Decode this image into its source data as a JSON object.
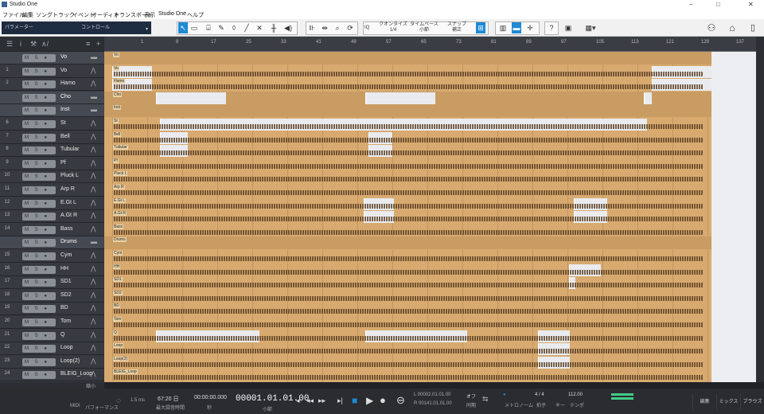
{
  "window": {
    "title": "Studio One"
  },
  "menu": [
    "ファイル",
    "編集",
    "ソング",
    "トラック",
    "イベント",
    "オーディオ",
    "トランスポート",
    "表示",
    "Studio One",
    "ヘルプ"
  ],
  "toolbar": {
    "param_label": "パラメーター",
    "control_label": "コントロール",
    "quantize_label": "クオンタイズ",
    "quantize_value": "1/4",
    "timebase_label": "タイムベース",
    "timebase_value": "小節",
    "snap_label": "スナップ",
    "snap_value": "補正",
    "iq_label": "IQ",
    "help_label": "?"
  },
  "ruler_marks": [
    "1",
    "9",
    "17",
    "25",
    "33",
    "41",
    "49",
    "57",
    "65",
    "73",
    "81",
    "89",
    "97",
    "105",
    "113",
    "121",
    "129",
    "137",
    "145"
  ],
  "tracks": [
    {
      "num": "",
      "name": "Vo",
      "folder": true
    },
    {
      "num": "1",
      "name": "Vo"
    },
    {
      "num": "2",
      "name": "Hamo"
    },
    {
      "num": "",
      "name": "Cho",
      "folder": true
    },
    {
      "num": "",
      "name": "Inst",
      "folder": true
    },
    {
      "num": "6",
      "name": "St"
    },
    {
      "num": "7",
      "name": "Bell"
    },
    {
      "num": "8",
      "name": "Tubular"
    },
    {
      "num": "9",
      "name": "Pf"
    },
    {
      "num": "10",
      "name": "Pluck L"
    },
    {
      "num": "11",
      "name": "Arp R"
    },
    {
      "num": "12",
      "name": "E.Gt L"
    },
    {
      "num": "13",
      "name": "A.Gt R"
    },
    {
      "num": "14",
      "name": "Bass"
    },
    {
      "num": "",
      "name": "Drums",
      "folder": true
    },
    {
      "num": "15",
      "name": "Cym"
    },
    {
      "num": "16",
      "name": "HH"
    },
    {
      "num": "17",
      "name": "SD1"
    },
    {
      "num": "18",
      "name": "SD2"
    },
    {
      "num": "19",
      "name": "BD"
    },
    {
      "num": "20",
      "name": "Tom"
    },
    {
      "num": "21",
      "name": "Q"
    },
    {
      "num": "22",
      "name": "Loop"
    },
    {
      "num": "23",
      "name": "Loop(2)"
    },
    {
      "num": "24",
      "name": "BLEIG_Loop"
    },
    {
      "num": "25",
      "name": "SE"
    }
  ],
  "track_button_text": "M S ● ◐",
  "transport": {
    "midi": "MIDI",
    "performance": "パフォーマンス",
    "latency": "1.5 ms",
    "rec_time": "67:20 日",
    "rec_label": "最大録音時間",
    "seconds": "00:00:00.000",
    "seconds_label": "秒",
    "position": "00001.01.01.00",
    "position_label": "小節",
    "loop_l": "L 00002.01.01.00",
    "loop_r": "R 00141.01.01.00",
    "off": "オフ",
    "sync": "同期",
    "metronome": "メトロノーム",
    "signature": "4 / 4",
    "signature_label": "拍子",
    "key_label": "キー",
    "tempo": "112.00",
    "tempo_label": "テンポ"
  },
  "tabs": {
    "edit": "編集",
    "mix": "ミックス",
    "browse": "ブラウズ"
  },
  "zoom_label": "縮小",
  "colors": {
    "event": "#d8aa70",
    "gap": "#e9ebef",
    "accent": "#1e8ad6"
  }
}
